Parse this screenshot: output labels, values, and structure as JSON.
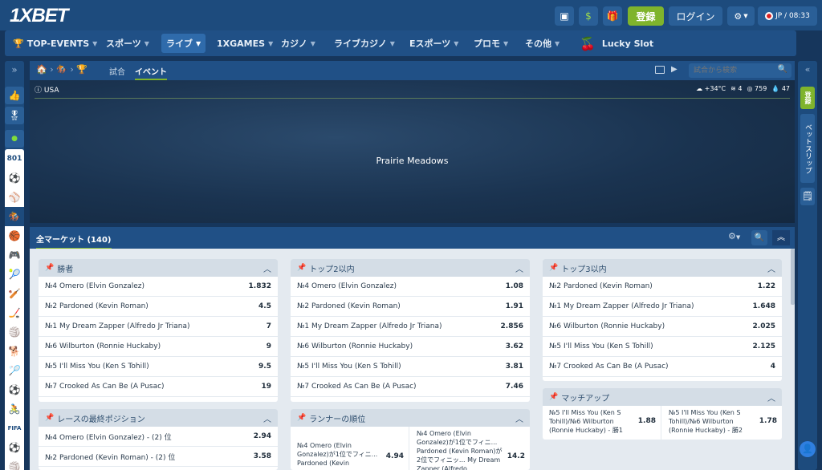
{
  "header": {
    "logo": "1XBET",
    "register": "登録",
    "login": "ログイン",
    "lang_time": "JP / 08:33"
  },
  "nav": [
    {
      "label": "TOP-EVENTS"
    },
    {
      "label": "スポーツ"
    },
    {
      "label": "ライブ"
    },
    {
      "label": "1XGAMES"
    },
    {
      "label": "カジノ"
    },
    {
      "label": "ライブカジノ"
    },
    {
      "label": "Eスポーツ"
    },
    {
      "label": "プロモ"
    },
    {
      "label": "その他"
    },
    {
      "label": "Lucky Slot"
    }
  ],
  "breadcrumb": {
    "tab1": "試合",
    "tab2": "イベント",
    "search_placeholder": "試合から検索"
  },
  "event": {
    "country": "USA",
    "venue": "Prairie Meadows",
    "temp": "+34°C",
    "wind": "4",
    "pressure": "759",
    "humidity": "47"
  },
  "left_sidebar": {
    "count": "801"
  },
  "right_sidebar": {
    "register": "登録",
    "betslip": "ベットスリップ"
  },
  "markets": {
    "title": "全マーケット (140)"
  },
  "cards": [
    {
      "title": "勝者",
      "rows": [
        {
          "name": "№4 Omero (Elvin Gonzalez)",
          "odd": "1.832"
        },
        {
          "name": "№2 Pardoned (Kevin Roman)",
          "odd": "4.5"
        },
        {
          "name": "№1 My Dream Zapper (Alfredo Jr Triana)",
          "odd": "7"
        },
        {
          "name": "№6 Wilburton (Ronnie Huckaby)",
          "odd": "9"
        },
        {
          "name": "№5 I'll Miss You (Ken S Tohill)",
          "odd": "9.5"
        },
        {
          "name": "№7 Crooked As Can Be (A Pusac)",
          "odd": "19"
        }
      ]
    },
    {
      "title": "トップ2以内",
      "rows": [
        {
          "name": "№4 Omero (Elvin Gonzalez)",
          "odd": "1.08"
        },
        {
          "name": "№2 Pardoned (Kevin Roman)",
          "odd": "1.91"
        },
        {
          "name": "№1 My Dream Zapper (Alfredo Jr Triana)",
          "odd": "2.856"
        },
        {
          "name": "№6 Wilburton (Ronnie Huckaby)",
          "odd": "3.62"
        },
        {
          "name": "№5 I'll Miss You (Ken S Tohill)",
          "odd": "3.81"
        },
        {
          "name": "№7 Crooked As Can Be (A Pusac)",
          "odd": "7.46"
        }
      ]
    },
    {
      "title": "トップ3以内",
      "rows": [
        {
          "name": "№2 Pardoned (Kevin Roman)",
          "odd": "1.22"
        },
        {
          "name": "№1 My Dream Zapper (Alfredo Jr Triana)",
          "odd": "1.648"
        },
        {
          "name": "№6 Wilburton (Ronnie Huckaby)",
          "odd": "2.025"
        },
        {
          "name": "№5 I'll Miss You (Ken S Tohill)",
          "odd": "2.125"
        },
        {
          "name": "№7 Crooked As Can Be (A Pusac)",
          "odd": "4"
        }
      ]
    },
    {
      "title": "レースの最終ポジション",
      "rows": [
        {
          "name": "№4 Omero (Elvin Gonzalez) - (2) 位",
          "odd": "2.94"
        },
        {
          "name": "№2 Pardoned (Kevin Roman) - (2) 位",
          "odd": "3.58"
        }
      ]
    },
    {
      "title": "ランナーの順位",
      "cells": [
        {
          "name": "№4 Omero (Elvin Gonzalez)が1位でフィニ... Pardoned (Kevin",
          "odd": "4.94"
        },
        {
          "name": "№4 Omero (Elvin Gonzalez)が1位でフィニ... Pardoned (Kevin Roman)が2位でフィニッ... My Dream Zapper (Alfredo",
          "odd": "14.2"
        }
      ]
    },
    {
      "title": "マッチアップ",
      "cells": [
        {
          "name": "№5 I'll Miss You (Ken S Tohill)/№6 Wilburton (Ronnie Huckaby) - 勝1",
          "odd": "1.88"
        },
        {
          "name": "№5 I'll Miss You (Ken S Tohill)/№6 Wilburton (Ronnie Huckaby) - 勝2",
          "odd": "1.78"
        }
      ]
    }
  ]
}
